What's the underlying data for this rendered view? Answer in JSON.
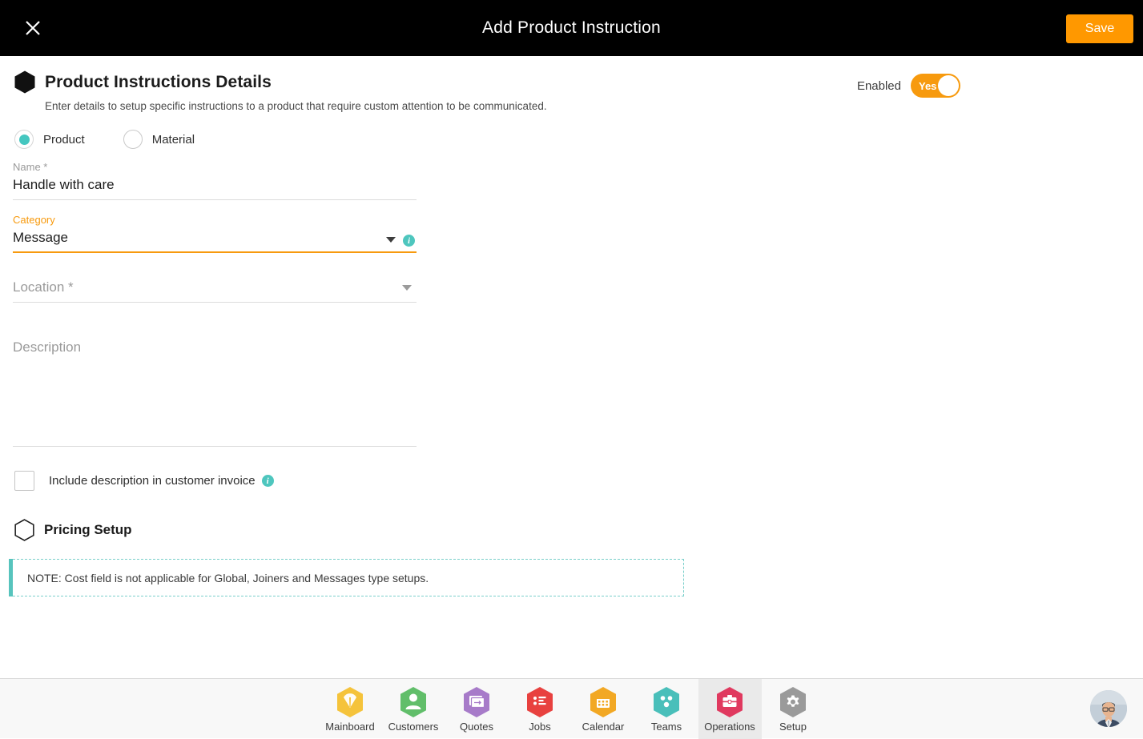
{
  "topbar": {
    "close_icon": "close-icon",
    "title": "Add Product Instruction",
    "save_label": "Save"
  },
  "section": {
    "icon": "hexagon-filled-icon",
    "title": "Product Instructions Details",
    "subtitle": "Enter details to setup specific instructions to a product that require custom attention to be communicated.",
    "enabled_label": "Enabled",
    "toggle_value": "Yes",
    "toggle_on": true,
    "toggle_color": "#F79A0E"
  },
  "type_radios": {
    "selected": "Product",
    "accent_color": "#45c7c0",
    "options": [
      {
        "label": "Product",
        "selected": true
      },
      {
        "label": "Material",
        "selected": false
      }
    ]
  },
  "fields": {
    "name": {
      "caption": "Name *",
      "value": "Handle with care",
      "active": false
    },
    "category": {
      "caption": "Category",
      "value": "Message",
      "active": true,
      "active_color": "#F79A0E",
      "caret_icon": "chevron-down-icon",
      "info_icon": "info-icon"
    },
    "location": {
      "caption": "Location *",
      "value": "",
      "active": false,
      "caret_icon": "chevron-down-icon"
    },
    "description": {
      "placeholder": "Description",
      "value": ""
    }
  },
  "invoice_checkbox": {
    "label": "Include description in customer invoice",
    "checked": false,
    "info_icon": "info-icon",
    "info_glyph": "i"
  },
  "pricing": {
    "icon": "hexagon-outline-icon",
    "title": "Pricing Setup",
    "note": "NOTE: Cost field is not applicable for Global, Joiners and Messages type setups.",
    "note_accent_color": "#57c4bd"
  },
  "bottom_nav": {
    "active": "Operations",
    "items": [
      {
        "label": "Mainboard",
        "icon": "mainboard-icon",
        "color": "#F5C33B",
        "active": false
      },
      {
        "label": "Customers",
        "icon": "person-icon",
        "color": "#61BE6A",
        "active": false
      },
      {
        "label": "Quotes",
        "icon": "quotes-icon",
        "color": "#A77BC9",
        "active": false
      },
      {
        "label": "Jobs",
        "icon": "list-icon",
        "color": "#E8413F",
        "active": false
      },
      {
        "label": "Calendar",
        "icon": "calendar-icon",
        "color": "#F2A824",
        "active": false
      },
      {
        "label": "Teams",
        "icon": "teams-icon",
        "color": "#49BFBA",
        "active": false
      },
      {
        "label": "Operations",
        "icon": "briefcase-icon",
        "color": "#E0395F",
        "active": true
      },
      {
        "label": "Setup",
        "icon": "gear-icon",
        "color": "#9A9A9A",
        "active": false
      }
    ],
    "avatar": "user-avatar"
  }
}
